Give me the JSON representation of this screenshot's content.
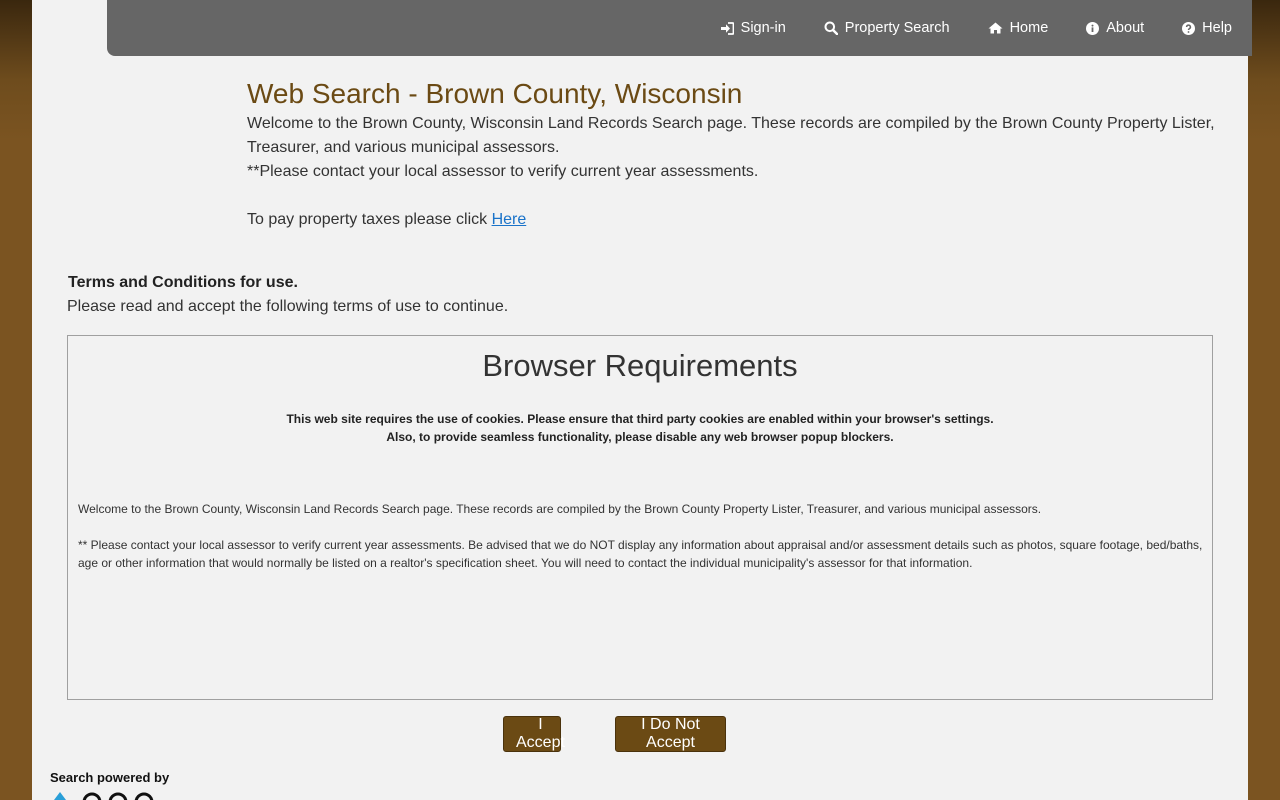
{
  "nav": {
    "items": [
      {
        "label": "Sign-in",
        "icon": "sign-in-icon"
      },
      {
        "label": "Property Search",
        "icon": "search-icon"
      },
      {
        "label": "Home",
        "icon": "home-icon"
      },
      {
        "label": "About",
        "icon": "info-icon"
      },
      {
        "label": "Help",
        "icon": "help-icon"
      }
    ]
  },
  "header": {
    "title": "Web Search - Brown County, Wisconsin",
    "intro": "Welcome to the Brown County, Wisconsin Land Records Search page. These records are compiled by the Brown County Property Lister, Treasurer, and various municipal assessors.",
    "assessor_note": "**Please contact your local assessor to verify current year assessments.",
    "pay_text": "To pay property taxes please click ",
    "pay_link": "Here"
  },
  "terms": {
    "heading": "Terms and Conditions for use.",
    "subheading": "Please read and accept the following terms of use to continue.",
    "box_title": "Browser Requirements",
    "cookie_note": "This web site requires the use of cookies. Please ensure that third party cookies are enabled within your browser's settings.",
    "popup_note": "Also, to provide seamless functionality, please disable any web browser popup blockers.",
    "body_welcome": "Welcome to the Brown County, Wisconsin Land Records Search page. These records are compiled by the Brown County Property Lister, Treasurer, and various municipal assessors.",
    "body_assessor": "** Please contact your local assessor to verify current year assessments. Be advised that we do NOT display any information about appraisal and/or assessment details such as photos, square footage, bed/baths, age or other information that would normally be listed on a realtor's specification sheet. You will need to contact the individual municipality's assessor for that information."
  },
  "buttons": {
    "accept": "I Accept",
    "decline": "I Do Not Accept"
  },
  "footer": {
    "powered_by": "Search powered by"
  },
  "colors": {
    "brand_brown": "#6b4a14",
    "nav_gray": "#666666",
    "link_blue": "#1a73c9"
  }
}
